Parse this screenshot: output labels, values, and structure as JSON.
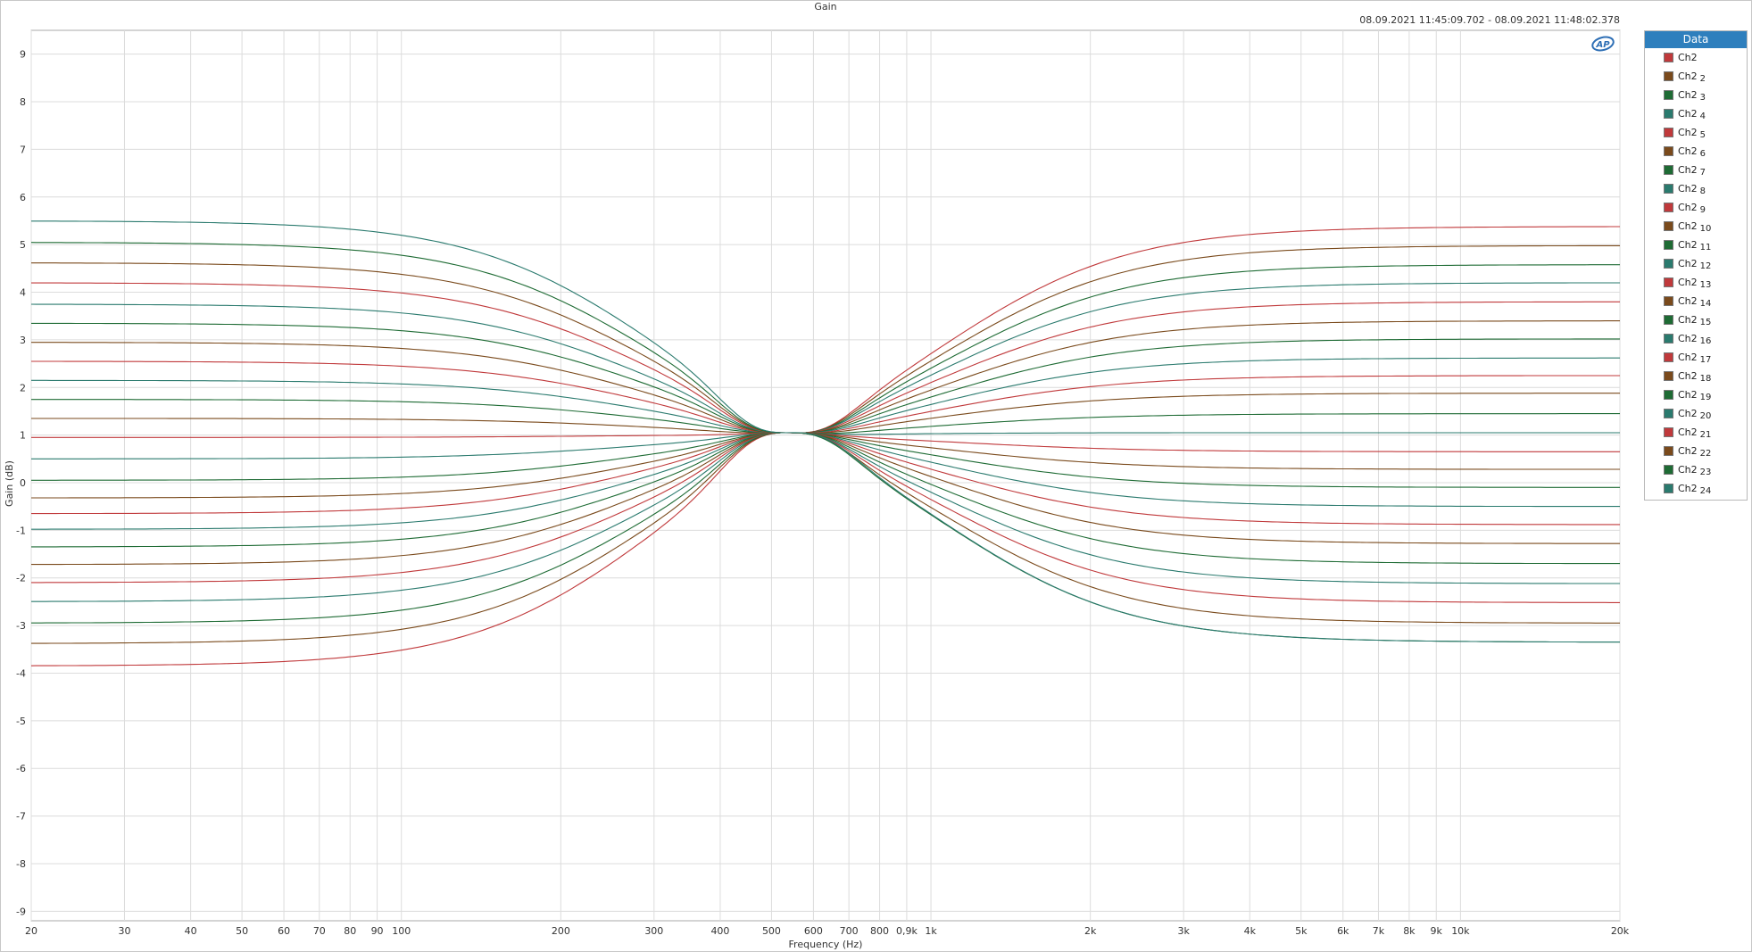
{
  "chart_data": {
    "type": "line",
    "title": "Gain",
    "timestamp": "08.09.2021 11:45:09.702 - 08.09.2021 11:48:02.378",
    "xlabel": "Frequency (Hz)",
    "ylabel": "Gain (dB)",
    "x_scale": "log",
    "xlim": [
      20,
      20000
    ],
    "ylim": [
      -9.2,
      9.5
    ],
    "grid": true,
    "x_ticks": [
      20,
      30,
      40,
      50,
      60,
      70,
      80,
      90,
      100,
      200,
      300,
      400,
      500,
      600,
      700,
      800,
      900,
      1000,
      2000,
      3000,
      4000,
      5000,
      6000,
      7000,
      8000,
      9000,
      10000,
      20000
    ],
    "x_tick_labels": [
      "20",
      "30",
      "40",
      "50",
      "60",
      "70",
      "80",
      "90",
      "100",
      "200",
      "300",
      "400",
      "500",
      "600",
      "700",
      "800",
      "0,9k",
      "1k",
      "2k",
      "3k",
      "4k",
      "5k",
      "6k",
      "7k",
      "8k",
      "9k",
      "10k",
      "20k"
    ],
    "y_ticks": [
      9,
      8,
      7,
      6,
      5,
      4,
      3,
      2,
      1,
      0,
      -1,
      -2,
      -3,
      -4,
      -5,
      -6,
      -7,
      -8,
      -9
    ],
    "y_tick_labels": [
      "9",
      "8",
      "7",
      "6",
      "5",
      "4",
      "3",
      "2",
      "1",
      "0",
      "-1",
      "-2",
      "-3",
      "-4",
      "-5",
      "-6",
      "-7",
      "-8",
      "-9"
    ],
    "pivot_x": 530,
    "pivot_y": 1.05,
    "legend_title": "Data",
    "legend_position": "right",
    "series": [
      {
        "name": "Ch2",
        "index": "",
        "color": "#c0393b",
        "low": -3.85,
        "high": 5.38
      },
      {
        "name": "Ch2",
        "index": "2",
        "color": "#7a4a1c",
        "low": -3.38,
        "high": 4.98
      },
      {
        "name": "Ch2",
        "index": "3",
        "color": "#1e6b34",
        "low": -2.95,
        "high": 4.58
      },
      {
        "name": "Ch2",
        "index": "4",
        "color": "#2a7a6e",
        "low": -2.5,
        "high": 4.2
      },
      {
        "name": "Ch2",
        "index": "5",
        "color": "#c0393b",
        "low": -2.1,
        "high": 3.8
      },
      {
        "name": "Ch2",
        "index": "6",
        "color": "#7a4a1c",
        "low": -1.72,
        "high": 3.4
      },
      {
        "name": "Ch2",
        "index": "7",
        "color": "#1e6b34",
        "low": -1.35,
        "high": 3.02
      },
      {
        "name": "Ch2",
        "index": "8",
        "color": "#2a7a6e",
        "low": -0.98,
        "high": 2.62
      },
      {
        "name": "Ch2",
        "index": "9",
        "color": "#c0393b",
        "low": -0.65,
        "high": 2.25
      },
      {
        "name": "Ch2",
        "index": "10",
        "color": "#7a4a1c",
        "low": -0.32,
        "high": 1.88
      },
      {
        "name": "Ch2",
        "index": "11",
        "color": "#1e6b34",
        "low": 0.05,
        "high": 1.45
      },
      {
        "name": "Ch2",
        "index": "12",
        "color": "#2a7a6e",
        "low": 0.5,
        "high": 1.05
      },
      {
        "name": "Ch2",
        "index": "13",
        "color": "#c0393b",
        "low": 0.95,
        "high": 0.65
      },
      {
        "name": "Ch2",
        "index": "14",
        "color": "#7a4a1c",
        "low": 1.35,
        "high": 0.28
      },
      {
        "name": "Ch2",
        "index": "15",
        "color": "#1e6b34",
        "low": 1.75,
        "high": -0.1
      },
      {
        "name": "Ch2",
        "index": "16",
        "color": "#2a7a6e",
        "low": 2.15,
        "high": -0.5
      },
      {
        "name": "Ch2",
        "index": "17",
        "color": "#c0393b",
        "low": 2.55,
        "high": -0.88
      },
      {
        "name": "Ch2",
        "index": "18",
        "color": "#7a4a1c",
        "low": 2.95,
        "high": -1.28
      },
      {
        "name": "Ch2",
        "index": "19",
        "color": "#1e6b34",
        "low": 3.35,
        "high": -1.7
      },
      {
        "name": "Ch2",
        "index": "20",
        "color": "#2a7a6e",
        "low": 3.75,
        "high": -2.12
      },
      {
        "name": "Ch2",
        "index": "21",
        "color": "#c0393b",
        "low": 4.2,
        "high": -2.52
      },
      {
        "name": "Ch2",
        "index": "22",
        "color": "#7a4a1c",
        "low": 4.62,
        "high": -2.95
      },
      {
        "name": "Ch2",
        "index": "23",
        "color": "#1e6b34",
        "low": 5.05,
        "high": -3.35
      },
      {
        "name": "Ch2",
        "index": "24",
        "color": "#2a7a6e",
        "low": 5.5,
        "high": -3.35
      }
    ]
  }
}
